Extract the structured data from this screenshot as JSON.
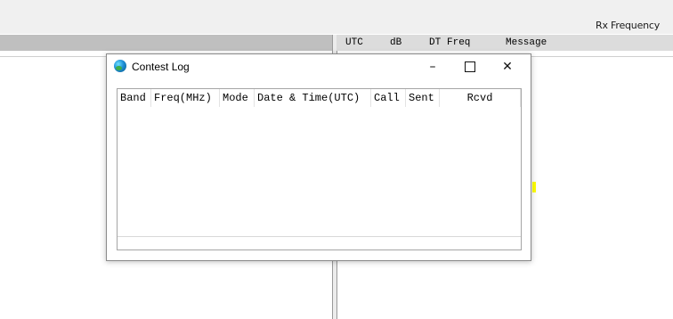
{
  "background": {
    "rx_frequency_label": "Rx Frequency",
    "band_activity_columns": [
      "UTC",
      "dB",
      "DT",
      "Freq",
      "Message"
    ]
  },
  "dialog": {
    "title": "Contest Log",
    "controls": {
      "minimize": "–",
      "maximize": "☐",
      "close": "✕"
    },
    "columns": [
      "Band",
      "Freq(MHz)",
      "Mode",
      "Date & Time(UTC)",
      "Call",
      "Sent",
      "Rcvd"
    ],
    "rows": []
  },
  "colors": {
    "highlight": "#ffff00",
    "header_bg": "#bfbfbf"
  }
}
